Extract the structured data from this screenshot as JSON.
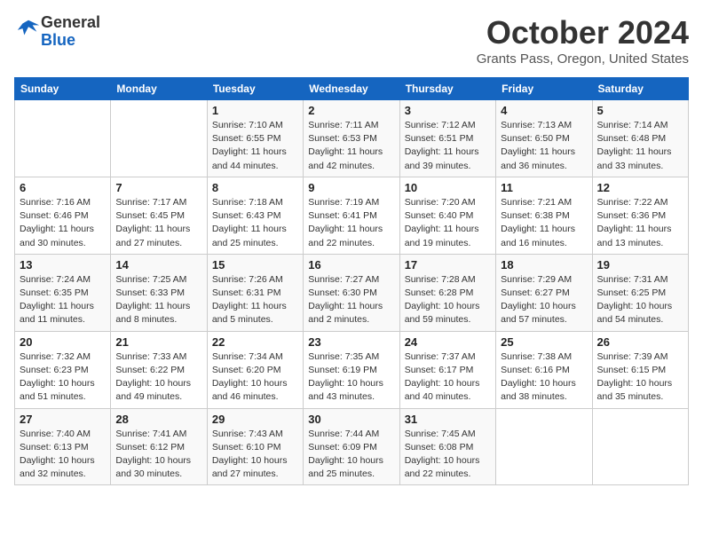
{
  "header": {
    "logo_line1": "General",
    "logo_line2": "Blue",
    "month": "October 2024",
    "location": "Grants Pass, Oregon, United States"
  },
  "weekdays": [
    "Sunday",
    "Monday",
    "Tuesday",
    "Wednesday",
    "Thursday",
    "Friday",
    "Saturday"
  ],
  "weeks": [
    [
      {
        "day": "",
        "info": ""
      },
      {
        "day": "",
        "info": ""
      },
      {
        "day": "1",
        "info": "Sunrise: 7:10 AM\nSunset: 6:55 PM\nDaylight: 11 hours and 44 minutes."
      },
      {
        "day": "2",
        "info": "Sunrise: 7:11 AM\nSunset: 6:53 PM\nDaylight: 11 hours and 42 minutes."
      },
      {
        "day": "3",
        "info": "Sunrise: 7:12 AM\nSunset: 6:51 PM\nDaylight: 11 hours and 39 minutes."
      },
      {
        "day": "4",
        "info": "Sunrise: 7:13 AM\nSunset: 6:50 PM\nDaylight: 11 hours and 36 minutes."
      },
      {
        "day": "5",
        "info": "Sunrise: 7:14 AM\nSunset: 6:48 PM\nDaylight: 11 hours and 33 minutes."
      }
    ],
    [
      {
        "day": "6",
        "info": "Sunrise: 7:16 AM\nSunset: 6:46 PM\nDaylight: 11 hours and 30 minutes."
      },
      {
        "day": "7",
        "info": "Sunrise: 7:17 AM\nSunset: 6:45 PM\nDaylight: 11 hours and 27 minutes."
      },
      {
        "day": "8",
        "info": "Sunrise: 7:18 AM\nSunset: 6:43 PM\nDaylight: 11 hours and 25 minutes."
      },
      {
        "day": "9",
        "info": "Sunrise: 7:19 AM\nSunset: 6:41 PM\nDaylight: 11 hours and 22 minutes."
      },
      {
        "day": "10",
        "info": "Sunrise: 7:20 AM\nSunset: 6:40 PM\nDaylight: 11 hours and 19 minutes."
      },
      {
        "day": "11",
        "info": "Sunrise: 7:21 AM\nSunset: 6:38 PM\nDaylight: 11 hours and 16 minutes."
      },
      {
        "day": "12",
        "info": "Sunrise: 7:22 AM\nSunset: 6:36 PM\nDaylight: 11 hours and 13 minutes."
      }
    ],
    [
      {
        "day": "13",
        "info": "Sunrise: 7:24 AM\nSunset: 6:35 PM\nDaylight: 11 hours and 11 minutes."
      },
      {
        "day": "14",
        "info": "Sunrise: 7:25 AM\nSunset: 6:33 PM\nDaylight: 11 hours and 8 minutes."
      },
      {
        "day": "15",
        "info": "Sunrise: 7:26 AM\nSunset: 6:31 PM\nDaylight: 11 hours and 5 minutes."
      },
      {
        "day": "16",
        "info": "Sunrise: 7:27 AM\nSunset: 6:30 PM\nDaylight: 11 hours and 2 minutes."
      },
      {
        "day": "17",
        "info": "Sunrise: 7:28 AM\nSunset: 6:28 PM\nDaylight: 10 hours and 59 minutes."
      },
      {
        "day": "18",
        "info": "Sunrise: 7:29 AM\nSunset: 6:27 PM\nDaylight: 10 hours and 57 minutes."
      },
      {
        "day": "19",
        "info": "Sunrise: 7:31 AM\nSunset: 6:25 PM\nDaylight: 10 hours and 54 minutes."
      }
    ],
    [
      {
        "day": "20",
        "info": "Sunrise: 7:32 AM\nSunset: 6:23 PM\nDaylight: 10 hours and 51 minutes."
      },
      {
        "day": "21",
        "info": "Sunrise: 7:33 AM\nSunset: 6:22 PM\nDaylight: 10 hours and 49 minutes."
      },
      {
        "day": "22",
        "info": "Sunrise: 7:34 AM\nSunset: 6:20 PM\nDaylight: 10 hours and 46 minutes."
      },
      {
        "day": "23",
        "info": "Sunrise: 7:35 AM\nSunset: 6:19 PM\nDaylight: 10 hours and 43 minutes."
      },
      {
        "day": "24",
        "info": "Sunrise: 7:37 AM\nSunset: 6:17 PM\nDaylight: 10 hours and 40 minutes."
      },
      {
        "day": "25",
        "info": "Sunrise: 7:38 AM\nSunset: 6:16 PM\nDaylight: 10 hours and 38 minutes."
      },
      {
        "day": "26",
        "info": "Sunrise: 7:39 AM\nSunset: 6:15 PM\nDaylight: 10 hours and 35 minutes."
      }
    ],
    [
      {
        "day": "27",
        "info": "Sunrise: 7:40 AM\nSunset: 6:13 PM\nDaylight: 10 hours and 32 minutes."
      },
      {
        "day": "28",
        "info": "Sunrise: 7:41 AM\nSunset: 6:12 PM\nDaylight: 10 hours and 30 minutes."
      },
      {
        "day": "29",
        "info": "Sunrise: 7:43 AM\nSunset: 6:10 PM\nDaylight: 10 hours and 27 minutes."
      },
      {
        "day": "30",
        "info": "Sunrise: 7:44 AM\nSunset: 6:09 PM\nDaylight: 10 hours and 25 minutes."
      },
      {
        "day": "31",
        "info": "Sunrise: 7:45 AM\nSunset: 6:08 PM\nDaylight: 10 hours and 22 minutes."
      },
      {
        "day": "",
        "info": ""
      },
      {
        "day": "",
        "info": ""
      }
    ]
  ]
}
